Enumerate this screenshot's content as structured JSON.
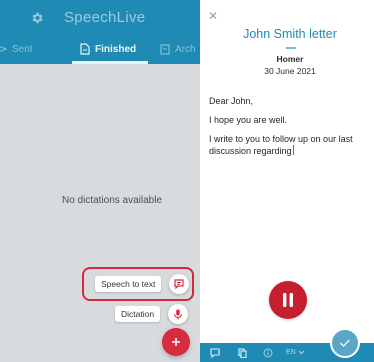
{
  "app": {
    "title": "SpeechLive",
    "settings_icon": "gear-icon",
    "accent_color": "#1f8bb5",
    "danger_color": "#d72b3f"
  },
  "tabs": [
    {
      "label": "Sent",
      "icon": "send-icon",
      "active": false
    },
    {
      "label": "Finished",
      "icon": "document-icon",
      "active": true
    },
    {
      "label": "Arch",
      "icon": "archive-icon",
      "active": false
    }
  ],
  "list": {
    "empty_message": "No dictations available"
  },
  "fab_menu": {
    "speech_to_text_label": "Speech to text",
    "speech_to_text_icon": "speech-to-text-icon",
    "dictation_label": "Dictation",
    "dictation_icon": "microphone-icon",
    "main_icon": "plus-icon"
  },
  "document": {
    "close_icon": "close-icon",
    "title": "John Smith letter",
    "author": "Homer",
    "date": "30 June 2021",
    "paragraphs": [
      "Dear John,",
      "I hope you are well.",
      "I write to you to follow up on our last discussion regarding"
    ]
  },
  "recorder": {
    "record_icon": "pause-icon"
  },
  "bottom_bar": {
    "icons": [
      "speech-bubble-icon",
      "copy-icon",
      "info-icon"
    ],
    "language": "EN",
    "language_icon": "chevron-down-icon",
    "confirm_icon": "check-icon"
  }
}
